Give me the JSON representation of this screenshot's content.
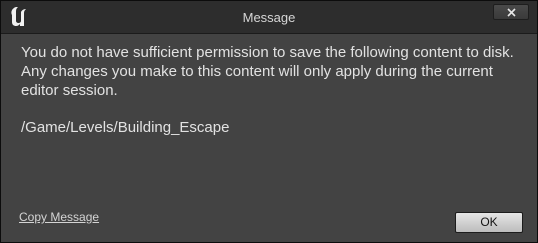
{
  "window": {
    "title": "Message",
    "logo_icon": "unreal-engine-logo",
    "close_icon": "close-icon"
  },
  "message": {
    "text": "You do not have sufficient permission to save the following content to disk. Any changes you make to this content will only apply during the current editor session.",
    "path": "/Game/Levels/Building_Escape"
  },
  "footer": {
    "copy_label": "Copy Message",
    "ok_label": "OK"
  },
  "colors": {
    "background": "#434343",
    "titlebar": "#2d2d2d",
    "text": "#e2e2e2",
    "button": "#d0d0d0"
  }
}
